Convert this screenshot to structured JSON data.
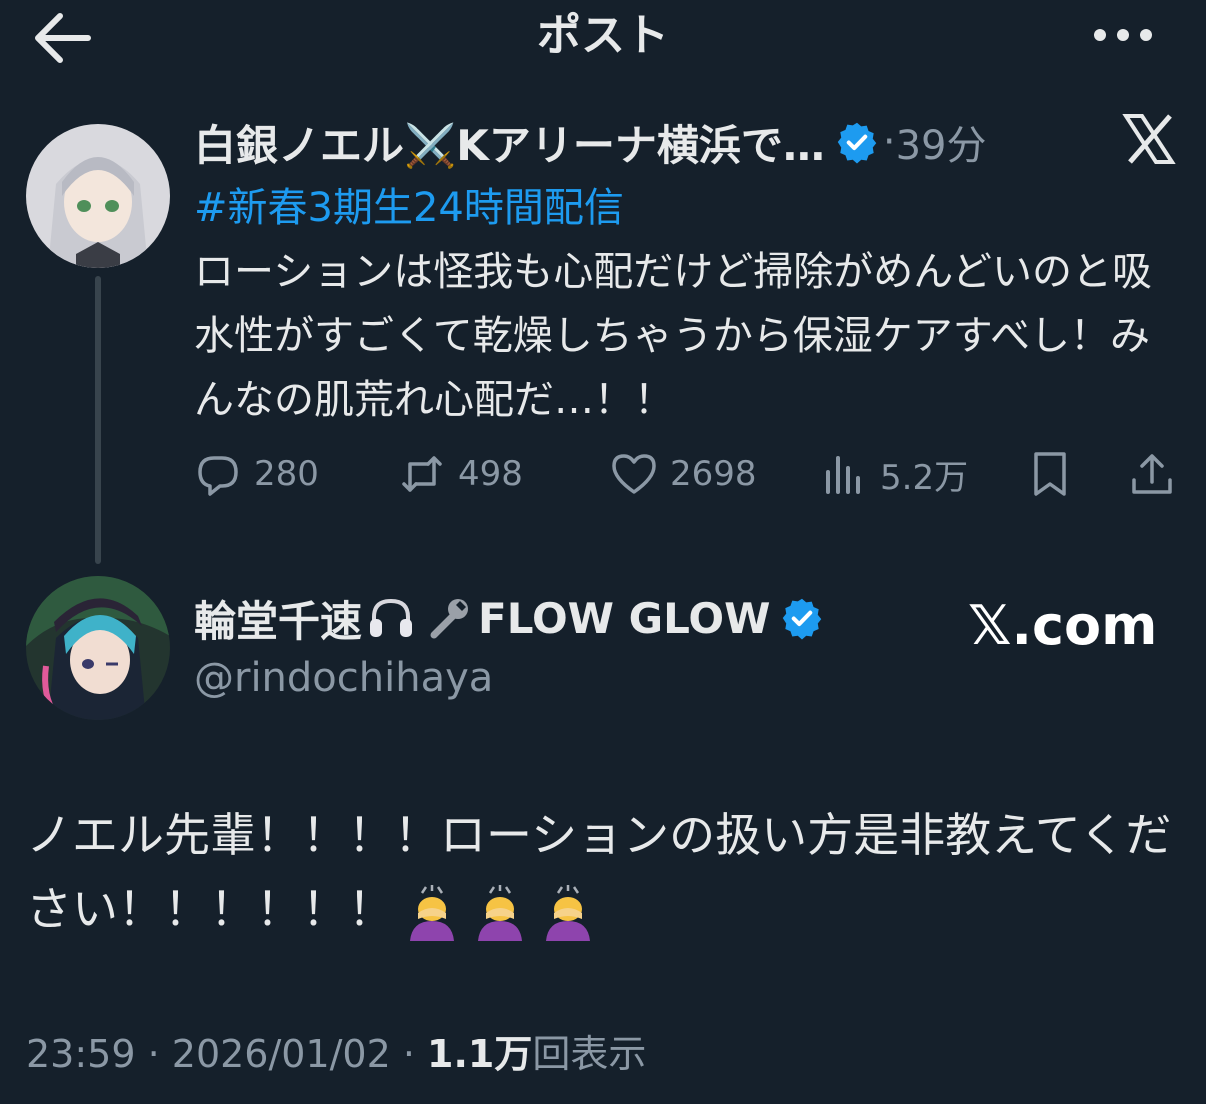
{
  "header": {
    "title": "ポスト"
  },
  "parent_post": {
    "display_name": "白銀ノエル⚔️Kアリーナ横浜で…",
    "time_separator": "·",
    "time_ago": "39分",
    "hashtag": "#新春3期生24時間配信",
    "text": "ローションは怪我も心配だけど掃除がめんどいのと吸水性がすごくて乾燥しちゃうから保湿ケアすべし！みんなの肌荒れ心配だ…！！",
    "stats": {
      "replies": "280",
      "reposts": "498",
      "likes": "2698",
      "views": "5.2万"
    }
  },
  "main_post": {
    "display_name": "輪堂千速",
    "name_suffix": "FLOW GLOW",
    "handle": "@rindochihaya",
    "watermark": "𝕏.com",
    "text": "ノエル先輩！！！！ローションの扱い方是非教えてください！！！！！！"
  },
  "meta": {
    "time": "23:59",
    "sep1": " · ",
    "date": "2026/01/02",
    "sep2": " · ",
    "views": "1.1万",
    "views_label": "回表示"
  },
  "colors": {
    "background": "#15202b",
    "text": "#e7e9ea",
    "secondary": "#8b98a5",
    "accent": "#1d9bf0",
    "verified": "#1d9bf0"
  },
  "icons": [
    "back-arrow-icon",
    "more-icon",
    "verified-icon",
    "x-logo-icon",
    "reply-icon",
    "repost-icon",
    "like-icon",
    "views-icon",
    "bookmark-icon",
    "share-icon",
    "headphones-icon",
    "wrench-icon",
    "bowing-person-icon"
  ]
}
